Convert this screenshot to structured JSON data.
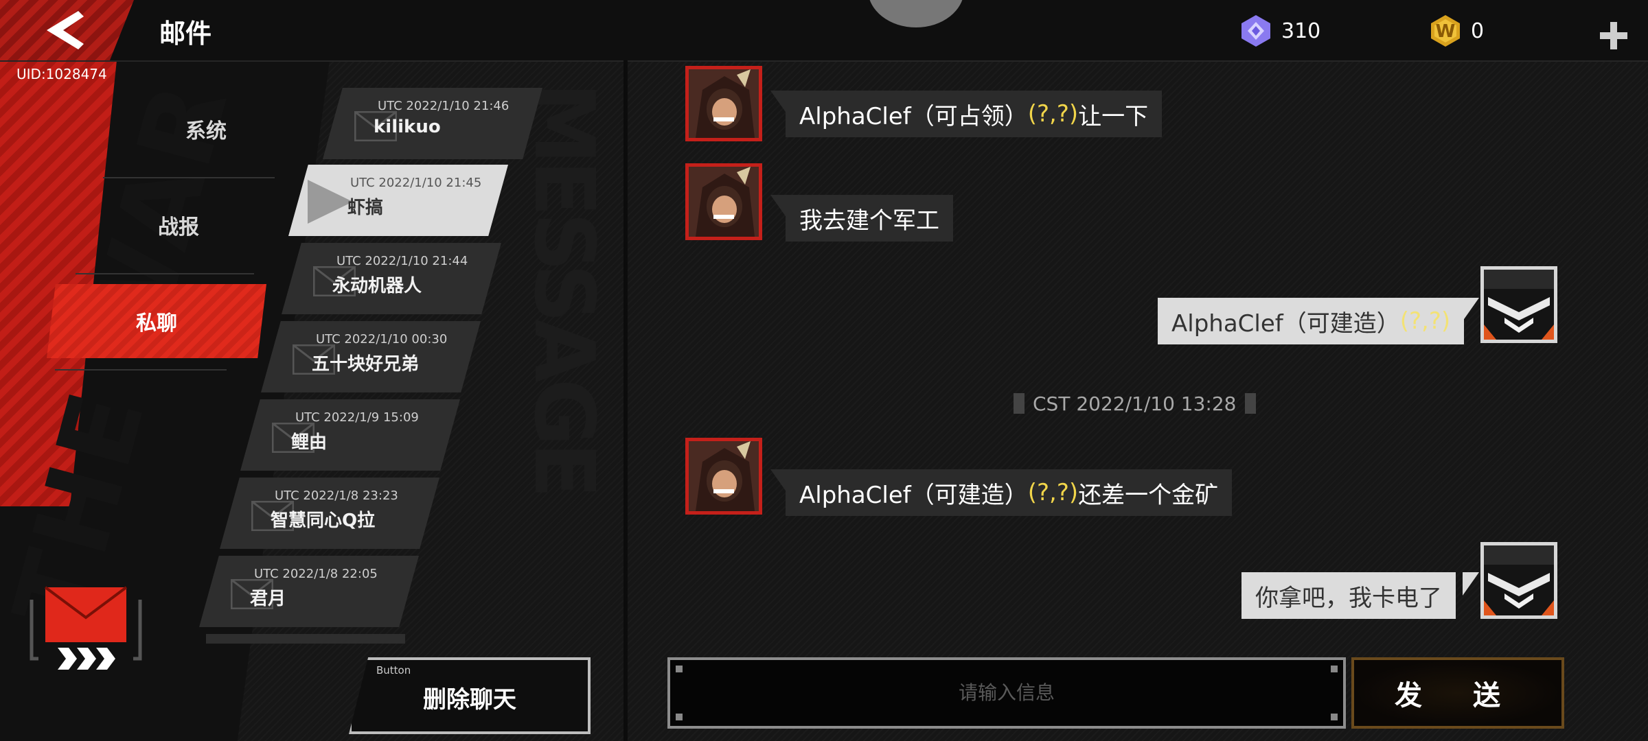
{
  "header": {
    "title": "邮件",
    "uid": "UID:1028474",
    "gem_count": "310",
    "coin_count": "0",
    "coin_letter": "W"
  },
  "poster_text": "THE WAR",
  "watermark_text": "MESSAGE",
  "categories": [
    {
      "label": "系统"
    },
    {
      "label": "战报"
    },
    {
      "label": "私聊"
    }
  ],
  "conversations": [
    {
      "time": "UTC 2022/1/10 21:46",
      "name": "kilikuo"
    },
    {
      "time": "UTC 2022/1/10 21:45",
      "name": "虾搞"
    },
    {
      "time": "UTC 2022/1/10 21:44",
      "name": "永动机器人"
    },
    {
      "time": "UTC 2022/1/10 00:30",
      "name": "五十块好兄弟"
    },
    {
      "time": "UTC 2022/1/9 15:09",
      "name": "鲤由"
    },
    {
      "time": "UTC 2022/1/8 23:23",
      "name": "智慧同心Q拉"
    },
    {
      "time": "UTC 2022/1/8 22:05",
      "name": "君月"
    }
  ],
  "delete_button": {
    "tag": "Button",
    "label": "删除聊天"
  },
  "messages": [
    {
      "prefix": "AlphaClef（可占领）",
      "coord": "(?,?)",
      "suffix": "让一下"
    },
    {
      "prefix": "我去建个军工",
      "coord": "",
      "suffix": ""
    },
    {
      "prefix": "AlphaClef（可建造）",
      "coord": "(?,?)",
      "suffix": ""
    },
    {
      "prefix": "AlphaClef（可建造）",
      "coord": "(?,?)",
      "suffix": "还差一个金矿"
    },
    {
      "prefix": "你拿吧，我卡电了",
      "coord": "",
      "suffix": ""
    }
  ],
  "timestamp_divider": "CST 2022/1/10 13:28",
  "input": {
    "placeholder": "请输入信息"
  },
  "send_button": {
    "label": "发 送"
  },
  "colors": {
    "accent_red": "#e02a1c",
    "coord_yellow": "#f1d54a",
    "send_border": "#6a4a1c"
  }
}
